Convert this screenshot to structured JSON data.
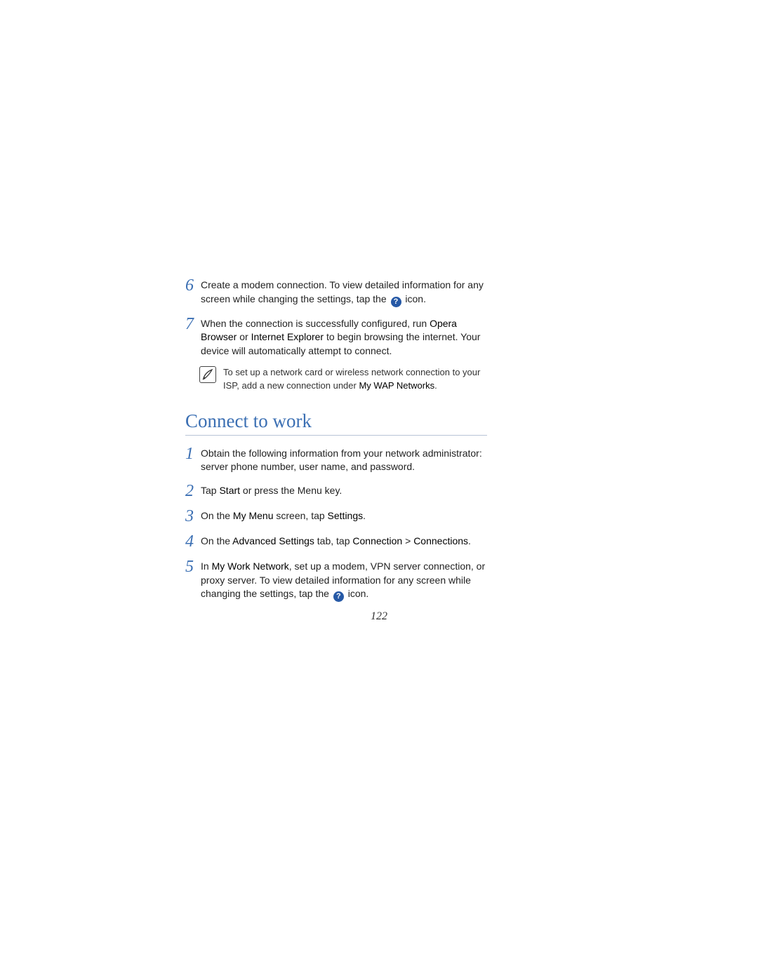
{
  "top_steps": [
    {
      "num": "6",
      "parts": [
        {
          "t": "Create a modem connection. To view detailed information for any screen while changing the settings, tap the "
        },
        {
          "icon": "help"
        },
        {
          "t": " icon."
        }
      ]
    },
    {
      "num": "7",
      "parts": [
        {
          "t": "When the connection is successfully configured, run "
        },
        {
          "ui": "Opera Browser"
        },
        {
          "t": " or "
        },
        {
          "ui": "Internet Explorer"
        },
        {
          "t": " to begin browsing the internet. Your device will automatically attempt to connect."
        }
      ]
    }
  ],
  "note": {
    "parts": [
      {
        "t": "To set up a network card or wireless network connection to your ISP, add a new connection under "
      },
      {
        "ui": "My WAP Networks"
      },
      {
        "t": "."
      }
    ]
  },
  "heading": "Connect to work",
  "work_steps": [
    {
      "num": "1",
      "parts": [
        {
          "t": "Obtain the following information from your network administrator: server phone number, user name, and password."
        }
      ]
    },
    {
      "num": "2",
      "parts": [
        {
          "t": "Tap "
        },
        {
          "ui": "Start"
        },
        {
          "t": " or press the Menu key."
        }
      ]
    },
    {
      "num": "3",
      "parts": [
        {
          "t": "On the "
        },
        {
          "ui": "My Menu"
        },
        {
          "t": " screen, tap "
        },
        {
          "ui": "Settings"
        },
        {
          "t": "."
        }
      ]
    },
    {
      "num": "4",
      "parts": [
        {
          "t": "On the "
        },
        {
          "ui": "Advanced Settings"
        },
        {
          "t": " tab, tap "
        },
        {
          "ui": "Connection"
        },
        {
          "t": " > "
        },
        {
          "ui": "Connections"
        },
        {
          "t": "."
        }
      ]
    },
    {
      "num": "5",
      "parts": [
        {
          "t": "In "
        },
        {
          "ui": "My Work Network"
        },
        {
          "t": ", set up a modem, VPN server connection, or proxy server. To view detailed information for any screen while changing the settings, tap the "
        },
        {
          "icon": "help"
        },
        {
          "t": " icon."
        }
      ]
    }
  ],
  "help_glyph": "?",
  "page_number": "122"
}
